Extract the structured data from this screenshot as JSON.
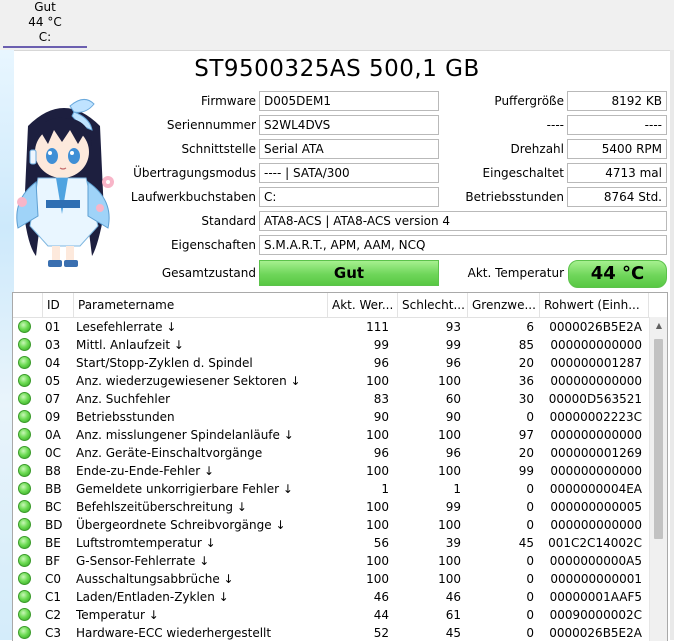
{
  "drive_tab": {
    "status": "Gut",
    "temperature": "44 °C",
    "letter": "C:"
  },
  "title": "ST9500325AS 500,1 GB",
  "info_left": [
    {
      "label": "Firmware",
      "value": "D005DEM1"
    },
    {
      "label": "Seriennummer",
      "value": "S2WL4DVS"
    },
    {
      "label": "Schnittstelle",
      "value": "Serial ATA"
    },
    {
      "label": "Übertragungsmodus",
      "value": "---- | SATA/300"
    },
    {
      "label": "Laufwerkbuchstaben",
      "value": "C:"
    }
  ],
  "info_right": [
    {
      "label": "Puffergröße",
      "value": "8192 KB"
    },
    {
      "label": "----",
      "value": "----"
    },
    {
      "label": "Drehzahl",
      "value": "5400 RPM"
    },
    {
      "label": "Eingeschaltet",
      "value": "4713 mal"
    },
    {
      "label": "Betriebsstunden",
      "value": "8764 Std."
    }
  ],
  "standard": {
    "label": "Standard",
    "value": "ATA8-ACS | ATA8-ACS version 4"
  },
  "features": {
    "label": "Eigenschaften",
    "value": "S.M.A.R.T., APM, AAM, NCQ"
  },
  "health": {
    "label": "Gesamtzustand",
    "value": "Gut"
  },
  "temperature": {
    "label": "Akt. Temperatur",
    "value": "44 °C"
  },
  "colors": {
    "good": "#6fd65a",
    "accent": "#6b5fb0"
  },
  "table": {
    "headers": [
      "ID",
      "Parametername",
      "Akt. Wer...",
      "Schlecht...",
      "Grenzwe...",
      "Rohwert (Einh..."
    ],
    "rows": [
      [
        "01",
        "Lesefehlerrate ↓",
        "111",
        "93",
        "6",
        "0000026B5E2A"
      ],
      [
        "03",
        "Mittl. Anlaufzeit ↓",
        "99",
        "99",
        "85",
        "000000000000"
      ],
      [
        "04",
        "Start/Stopp-Zyklen d. Spindel",
        "96",
        "96",
        "20",
        "000000001287"
      ],
      [
        "05",
        "Anz. wiederzugewiesener Sektoren ↓",
        "100",
        "100",
        "36",
        "000000000000"
      ],
      [
        "07",
        "Anz. Suchfehler",
        "83",
        "60",
        "30",
        "00000D563521"
      ],
      [
        "09",
        "Betriebsstunden",
        "90",
        "90",
        "0",
        "00000002223C"
      ],
      [
        "0A",
        "Anz. misslungener Spindelanläufe ↓",
        "100",
        "100",
        "97",
        "000000000000"
      ],
      [
        "0C",
        "Anz. Geräte-Einschaltvorgänge",
        "96",
        "96",
        "20",
        "000000001269"
      ],
      [
        "B8",
        "Ende-zu-Ende-Fehler ↓",
        "100",
        "100",
        "99",
        "000000000000"
      ],
      [
        "BB",
        "Gemeldete unkorrigierbare Fehler ↓",
        "1",
        "1",
        "0",
        "0000000004EA"
      ],
      [
        "BC",
        "Befehlszeitüberschreitung ↓",
        "100",
        "99",
        "0",
        "000000000005"
      ],
      [
        "BD",
        "Übergeordnete Schreibvorgänge ↓",
        "100",
        "100",
        "0",
        "000000000000"
      ],
      [
        "BE",
        "Luftstromtemperatur ↓",
        "56",
        "39",
        "45",
        "001C2C14002C"
      ],
      [
        "BF",
        "G-Sensor-Fehlerrate ↓",
        "100",
        "100",
        "0",
        "0000000000A5"
      ],
      [
        "C0",
        "Ausschaltungsabbrüche ↓",
        "100",
        "100",
        "0",
        "000000000001"
      ],
      [
        "C1",
        "Laden/Entladen-Zyklen ↓",
        "46",
        "46",
        "0",
        "00000001AAF5"
      ],
      [
        "C2",
        "Temperatur ↓",
        "44",
        "61",
        "0",
        "00090000002C"
      ],
      [
        "C3",
        "Hardware-ECC wiederhergestellt",
        "52",
        "45",
        "0",
        "0000026B5E2A"
      ]
    ]
  }
}
